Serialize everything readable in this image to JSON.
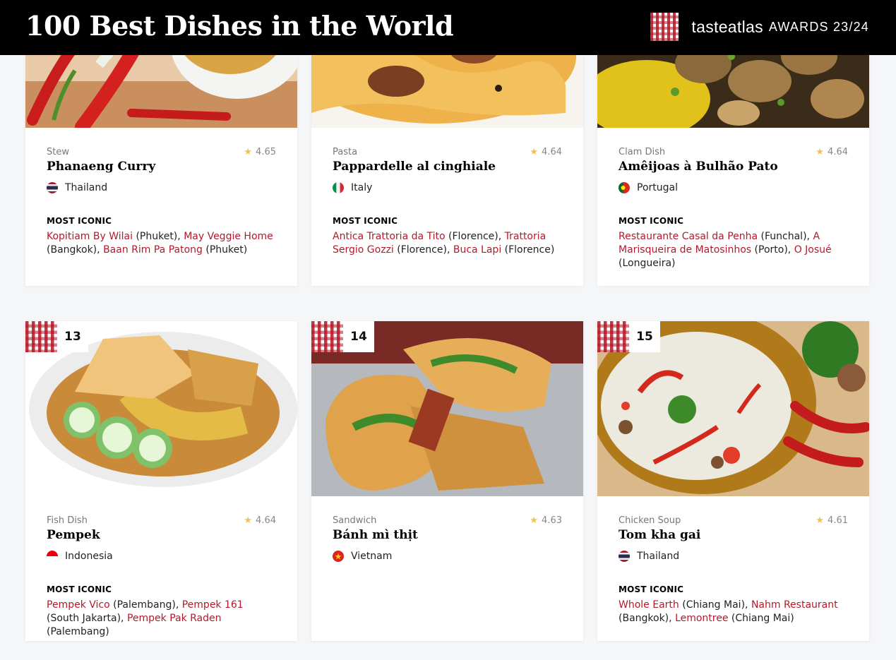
{
  "header": {
    "title": "100 Best Dishes in the World",
    "brand_name": "tasteatlas",
    "awards": "AWARDS 23/24"
  },
  "labels": {
    "most_iconic": "MOST ICONIC"
  },
  "colors": {
    "accent_link": "#b21a2a",
    "star": "#f2c14e",
    "header_bg": "#000000"
  },
  "cards": [
    {
      "rank": "",
      "category": "Stew",
      "rating": "4.65",
      "name": "Phanaeng Curry",
      "country": "Thailand",
      "flag": "thailand-flag-icon",
      "most_iconic": [
        {
          "place": "Kopitiam By Wilai",
          "city": " (Phuket), "
        },
        {
          "place": "May Veggie Home",
          "city": " (Bangkok), "
        },
        {
          "place": "Baan Rim Pa Patong",
          "city": " (Phuket)"
        }
      ]
    },
    {
      "rank": "",
      "category": "Pasta",
      "rating": "4.64",
      "name": "Pappardelle al cinghiale",
      "country": "Italy",
      "flag": "italy-flag-icon",
      "most_iconic": [
        {
          "place": "Antica Trattoria da Tito",
          "city": " (Florence), "
        },
        {
          "place": "Trattoria Sergio Gozzi",
          "city": " (Florence), "
        },
        {
          "place": "Buca Lapi",
          "city": " (Florence)"
        }
      ]
    },
    {
      "rank": "",
      "category": "Clam Dish",
      "rating": "4.64",
      "name": "Amêijoas à Bulhão Pato",
      "country": "Portugal",
      "flag": "portugal-flag-icon",
      "most_iconic": [
        {
          "place": "Restaurante Casal da Penha",
          "city": " (Funchal), "
        },
        {
          "place": "A Marisqueira de Matosinhos",
          "city": " (Porto), "
        },
        {
          "place": "O Josué",
          "city": " (Longueira)"
        }
      ]
    },
    {
      "rank": "13",
      "category": "Fish Dish",
      "rating": "4.64",
      "name": "Pempek",
      "country": "Indonesia",
      "flag": "indonesia-flag-icon",
      "most_iconic": [
        {
          "place": "Pempek Vico",
          "city": " (Palembang), "
        },
        {
          "place": "Pempek 161",
          "city": " (South Jakarta), "
        },
        {
          "place": "Pempek Pak Raden",
          "city": " (Palembang)"
        }
      ]
    },
    {
      "rank": "14",
      "category": "Sandwich",
      "rating": "4.63",
      "name": "Bánh mì thịt",
      "country": "Vietnam",
      "flag": "vietnam-flag-icon",
      "most_iconic": []
    },
    {
      "rank": "15",
      "category": "Chicken Soup",
      "rating": "4.61",
      "name": "Tom kha gai",
      "country": "Thailand",
      "flag": "thailand-flag-icon",
      "most_iconic": [
        {
          "place": "Whole Earth",
          "city": " (Chiang Mai), "
        },
        {
          "place": "Nahm Restaurant",
          "city": " (Bangkok), "
        },
        {
          "place": "Lemontree",
          "city": " (Chiang Mai)"
        }
      ]
    }
  ]
}
